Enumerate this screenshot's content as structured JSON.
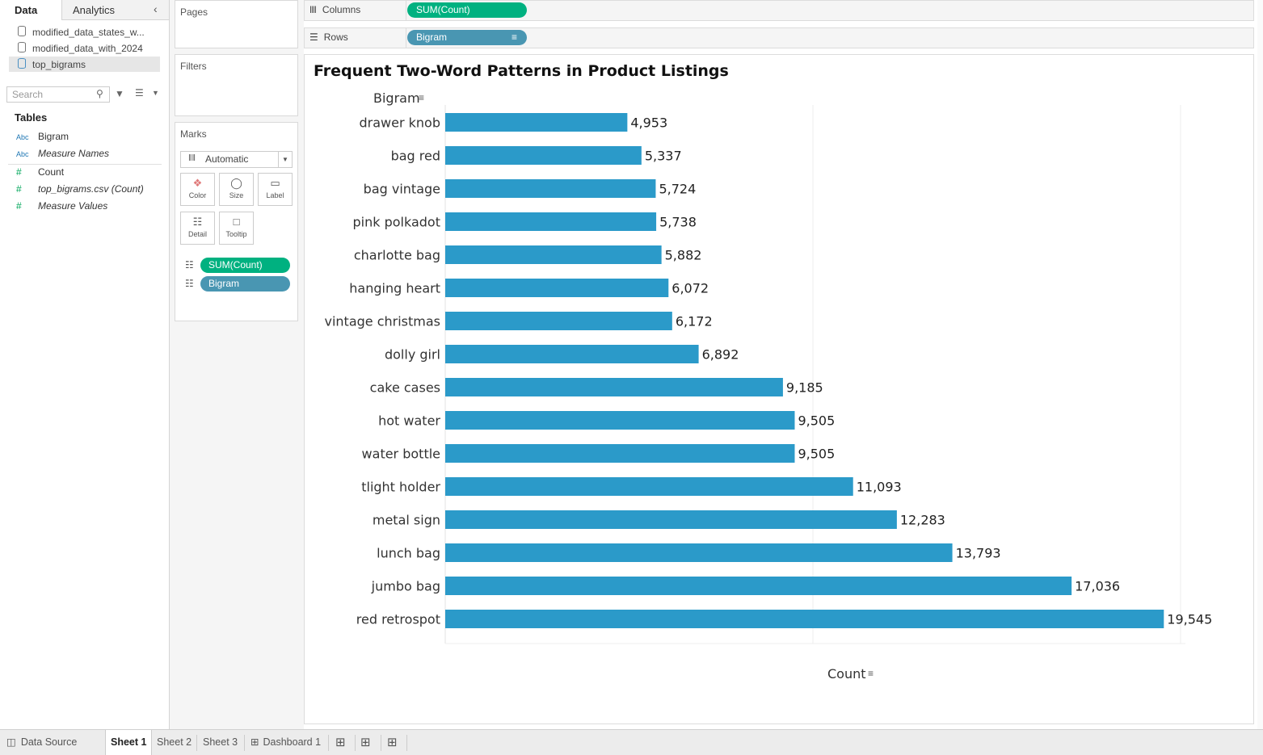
{
  "left_pane": {
    "tab_data": "Data",
    "tab_analytics": "Analytics",
    "datasources": [
      "modified_data_states_w...",
      "modified_data_with_2024",
      "top_bigrams"
    ],
    "search_placeholder": "Search",
    "tables_heading": "Tables",
    "fields": [
      {
        "type": "Abc",
        "name": "Bigram"
      },
      {
        "type": "Abc",
        "name": "Measure Names"
      },
      {
        "type": "#",
        "name": "Count"
      },
      {
        "type": "#",
        "name": "top_bigrams.csv (Count)"
      },
      {
        "type": "#",
        "name": "Measure Values"
      }
    ]
  },
  "cards": {
    "pages": "Pages",
    "filters": "Filters",
    "marks": "Marks",
    "marks_type": "Automatic",
    "buttons": [
      "Color",
      "Size",
      "Label",
      "Detail",
      "Tooltip"
    ],
    "pills": [
      "SUM(Count)",
      "Bigram"
    ]
  },
  "shelves": {
    "columns_label": "Columns",
    "columns_pill": "SUM(Count)",
    "rows_label": "Rows",
    "rows_pill": "Bigram"
  },
  "colors": {
    "bar": "#2b9ac9",
    "measure_pill": "#00b180",
    "dimension_pill": "#4996b2"
  },
  "chart_data": {
    "type": "bar",
    "orientation": "horizontal",
    "title": "Frequent Two-Word Patterns in Product Listings",
    "ylabel": "Bigram",
    "xlabel": "Count",
    "xlim": [
      0,
      20000
    ],
    "grid": true,
    "categories": [
      "drawer knob",
      "bag red",
      "bag vintage",
      "pink polkadot",
      "charlotte bag",
      "hanging heart",
      "vintage christmas",
      "dolly girl",
      "cake cases",
      "hot water",
      "water bottle",
      "tlight holder",
      "metal sign",
      "lunch bag",
      "jumbo bag",
      "red retrospot"
    ],
    "values": [
      4953,
      5337,
      5724,
      5738,
      5882,
      6072,
      6172,
      6892,
      9185,
      9505,
      9505,
      11093,
      12283,
      13793,
      17036,
      19545
    ],
    "data_labels": [
      "4,953",
      "5,337",
      "5,724",
      "5,738",
      "5,882",
      "6,072",
      "6,172",
      "6,892",
      "9,185",
      "9,505",
      "9,505",
      "11,093",
      "12,283",
      "13,793",
      "17,036",
      "19,545"
    ]
  },
  "bottom_tabs": [
    "Data Source",
    "Sheet 1",
    "Sheet 2",
    "Sheet 3",
    "Dashboard 1"
  ]
}
